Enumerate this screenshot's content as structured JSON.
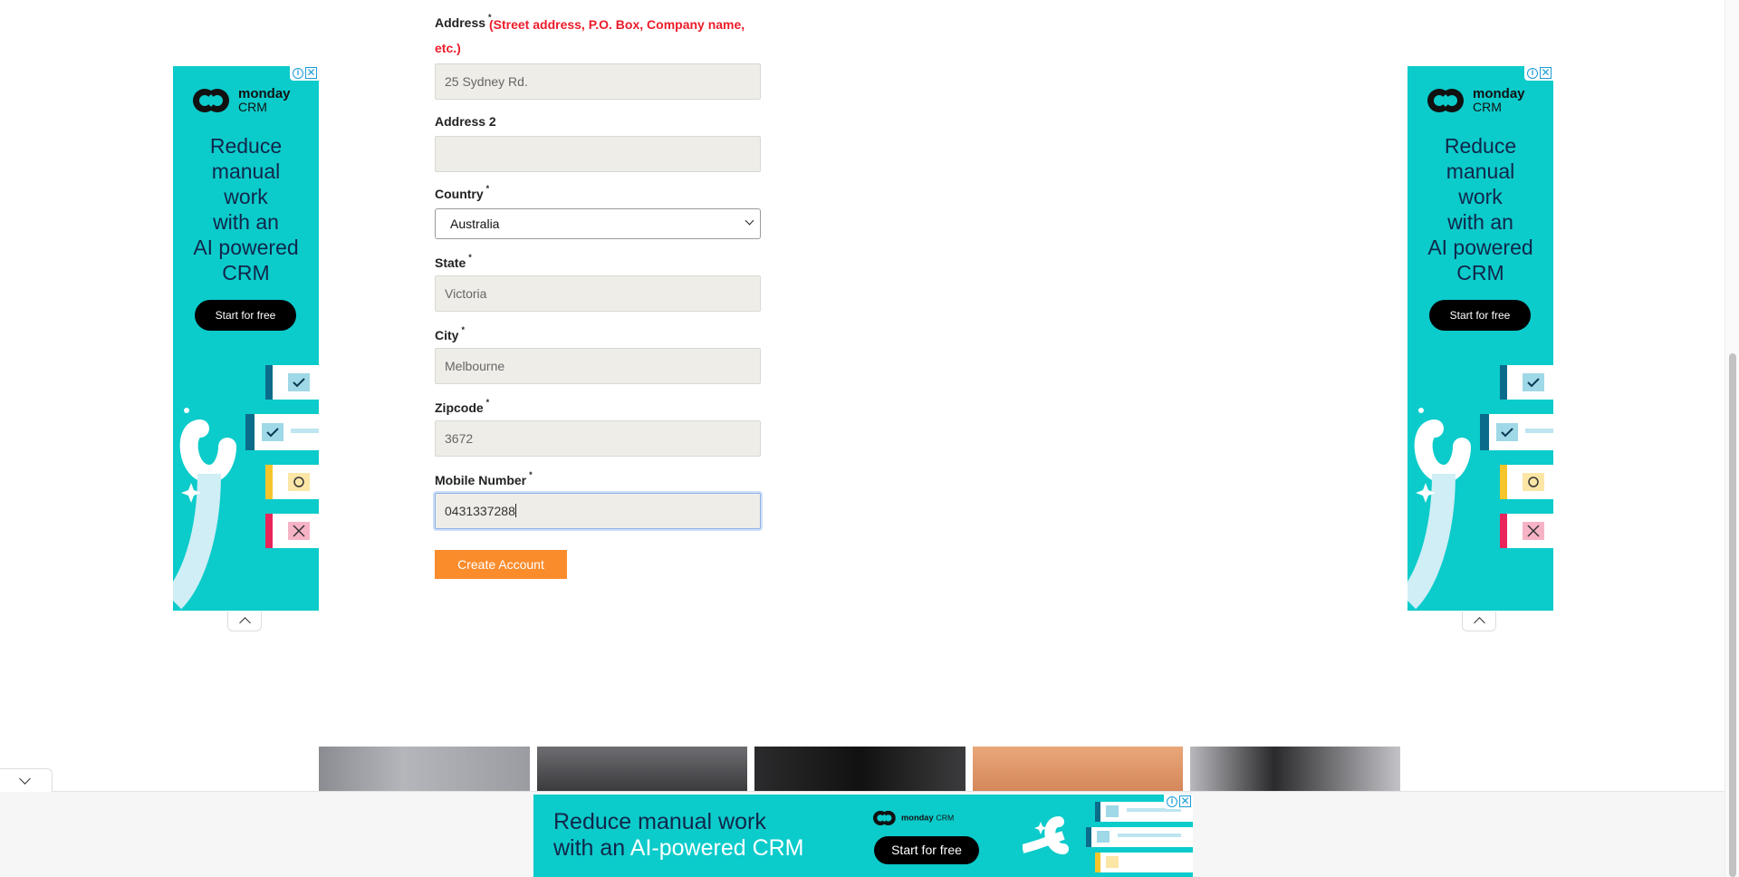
{
  "form": {
    "address": {
      "label": "Address",
      "required_mark": "*",
      "hint": "(Street address, P.O. Box, Company name, etc.)",
      "value": "25 Sydney Rd."
    },
    "address2": {
      "label": "Address 2",
      "value": ""
    },
    "country": {
      "label": "Country",
      "required_mark": "*",
      "value": "Australia"
    },
    "state": {
      "label": "State",
      "required_mark": "*",
      "value": "Victoria"
    },
    "city": {
      "label": "City",
      "required_mark": "*",
      "value": "Melbourne"
    },
    "zipcode": {
      "label": "Zipcode",
      "required_mark": "*",
      "value": "3672"
    },
    "mobile": {
      "label": "Mobile Number",
      "required_mark": "*",
      "value": "0431337288"
    },
    "submit_label": "Create Account"
  },
  "ads": {
    "brand_name": "monday",
    "brand_sub": "CRM",
    "side_headline_lines": [
      "Reduce",
      "manual",
      "work",
      "with an",
      "AI powered",
      "CRM"
    ],
    "cta": "Start for free",
    "adchoices_icon": "info-icon",
    "close_glyph": "✕",
    "bottom_headline_line1": "Reduce manual work",
    "bottom_headline_prefix": "with an ",
    "bottom_headline_highlight": "AI-powered CRM"
  },
  "colors": {
    "ad_teal": "#0ccbcb",
    "button_orange": "#fb8c2c",
    "required_red": "#ec1c2a",
    "field_bg": "#eeede8"
  }
}
